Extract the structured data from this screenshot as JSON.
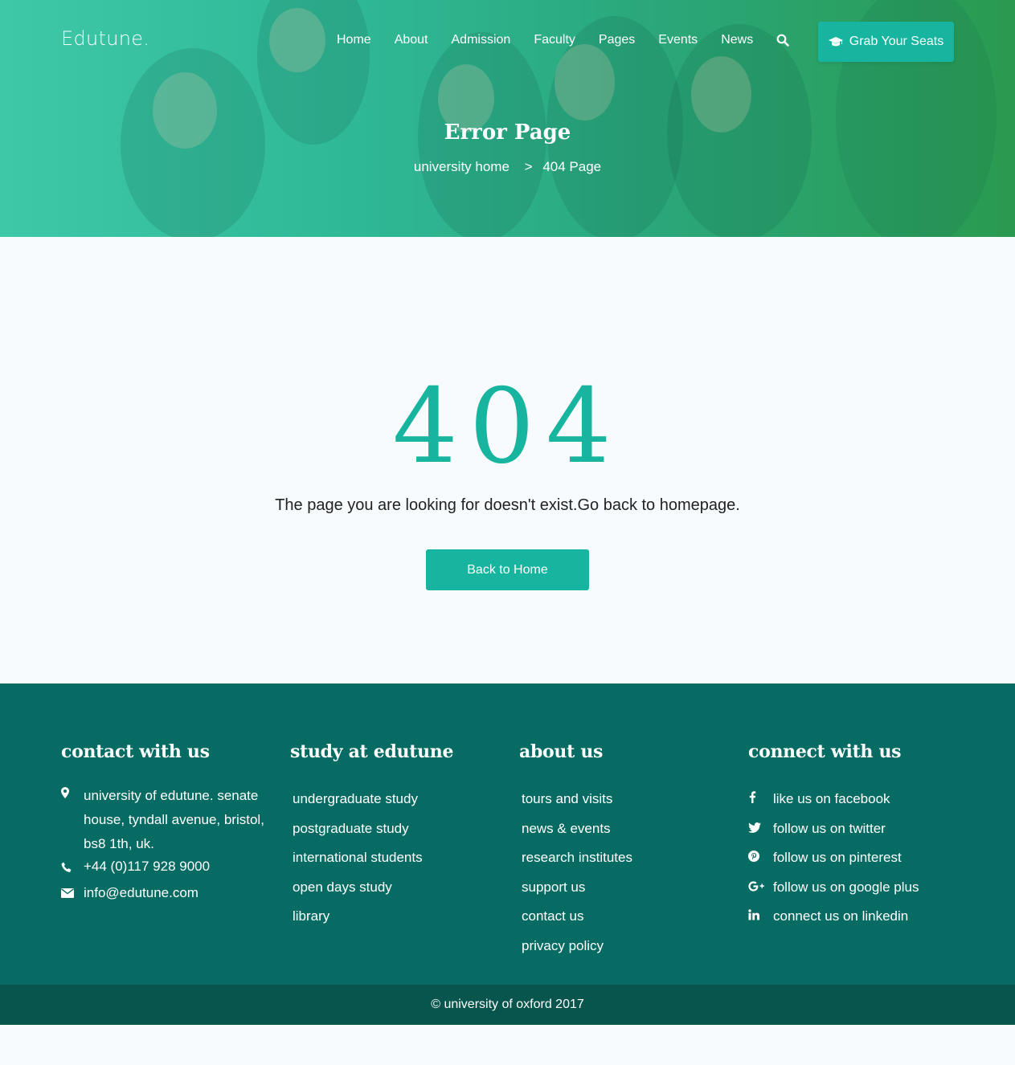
{
  "brand": {
    "logo": "Edutune."
  },
  "nav": {
    "items": [
      "Home",
      "About",
      "Admission",
      "Faculty",
      "Pages",
      "Events",
      "News"
    ],
    "search_icon": "search-icon",
    "cta_label": "Grab Your Seats",
    "cta_icon": "graduation-cap-icon"
  },
  "hero": {
    "title": "Error Page",
    "breadcrumb": {
      "home": "university home",
      "separator": ">",
      "current": "404 Page"
    }
  },
  "error": {
    "code": "404",
    "message": "The page you are looking for doesn't exist.Go back to homepage.",
    "button_label": "Back to Home"
  },
  "footer": {
    "contact": {
      "title": "contact with us",
      "address": "university of edutune. senate house, tyndall avenue, bristol, bs8 1th, uk.",
      "phone": "+44 (0)117 928 9000",
      "email": "info@edutune.com"
    },
    "study": {
      "title": "study at edutune",
      "links": [
        "undergraduate study",
        "postgraduate study",
        "international students",
        "open days study",
        "library"
      ]
    },
    "about": {
      "title": "about us",
      "links": [
        "tours and visits",
        "news & events",
        "research institutes",
        "support us",
        "contact us",
        "privacy policy"
      ]
    },
    "connect": {
      "title": "connect with us",
      "links": [
        {
          "icon": "facebook-icon",
          "label": "like us on facebook"
        },
        {
          "icon": "twitter-icon",
          "label": "follow us on twitter"
        },
        {
          "icon": "pinterest-icon",
          "label": "follow us on pinterest"
        },
        {
          "icon": "google-plus-icon",
          "label": "follow us on google plus"
        },
        {
          "icon": "linkedin-icon",
          "label": "connect us on linkedin"
        }
      ]
    },
    "copyright": "© university of oxford 2017"
  },
  "colors": {
    "accent": "#17b59f",
    "footer": "#056b63",
    "footer_bottom": "#07554d"
  }
}
